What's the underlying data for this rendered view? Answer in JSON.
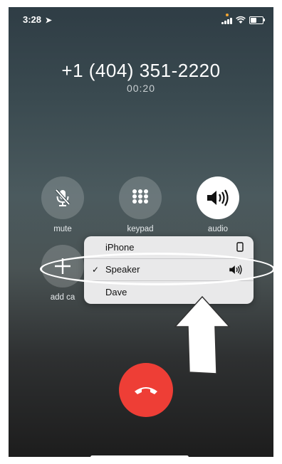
{
  "status_bar": {
    "time": "3:28",
    "location_glyph": "➤",
    "signal_bars": 4,
    "battery_level": 0.5
  },
  "call": {
    "number": "+1 (404) 351-2220",
    "duration": "00:20"
  },
  "controls": [
    {
      "id": "mute",
      "label": "mute",
      "icon": "mic-off-icon"
    },
    {
      "id": "keypad",
      "label": "keypad",
      "icon": "keypad-icon"
    },
    {
      "id": "audio",
      "label": "audio",
      "icon": "speaker-icon",
      "active": true
    },
    {
      "id": "add-call",
      "label": "add ca",
      "icon": "plus-icon"
    }
  ],
  "audio_menu": {
    "items": [
      {
        "label": "iPhone",
        "icon": "phone-icon",
        "selected": false
      },
      {
        "label": "Speaker",
        "icon": "speaker-icon",
        "selected": true,
        "check": "✓"
      },
      {
        "label": "Dave",
        "icon": "",
        "selected": false
      }
    ]
  },
  "colors": {
    "end_call": "#ee3e36",
    "menu_bg": "#e9e9ea",
    "annotation": "#ffffff"
  }
}
